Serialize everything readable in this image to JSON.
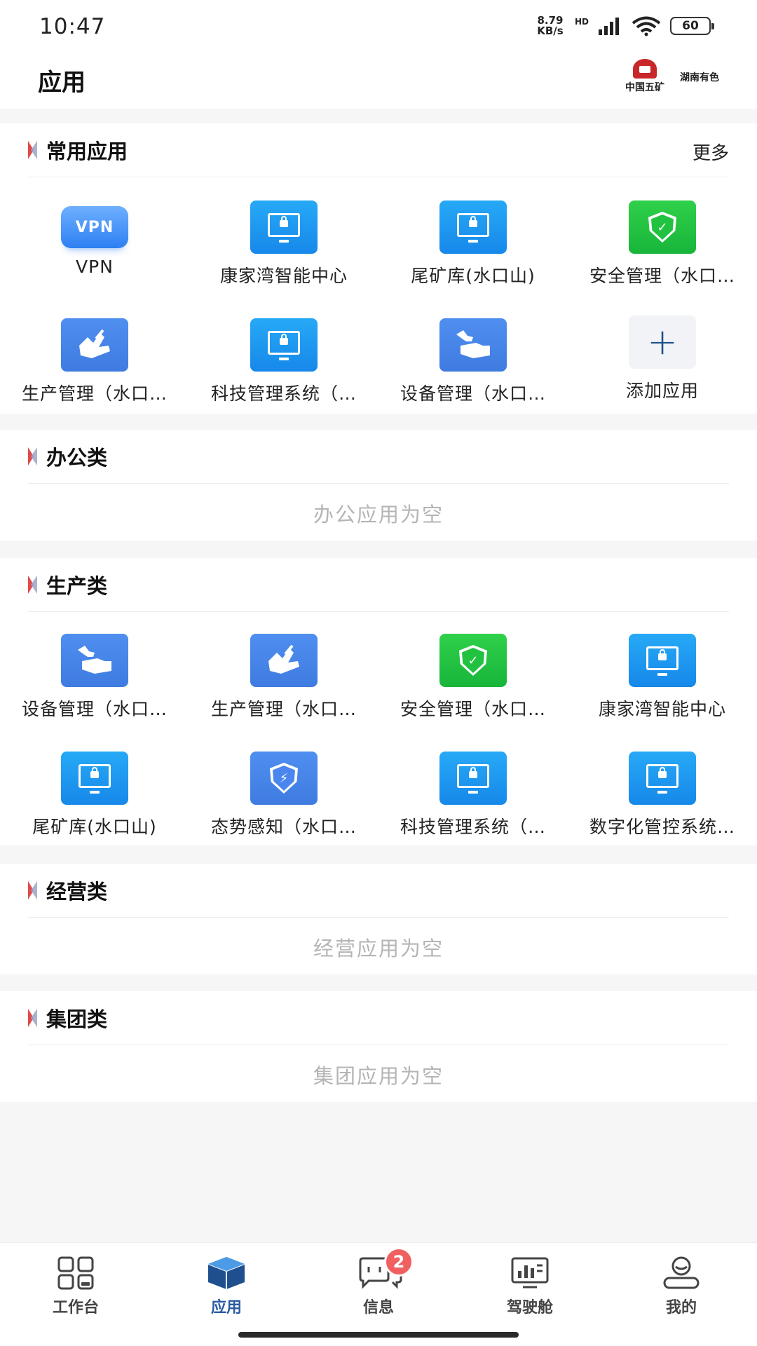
{
  "status_bar": {
    "time": "10:47",
    "net_speed_value": "8.79",
    "net_speed_unit": "KB/s",
    "hd": "HD",
    "battery": "60"
  },
  "header": {
    "title": "应用",
    "logo_left": "中国五矿",
    "logo_right": "湖南有色"
  },
  "common": {
    "title": "常用应用",
    "more": "更多",
    "apps": [
      {
        "label": "VPN",
        "icon": "vpn-icon",
        "icon_text": "VPN"
      },
      {
        "label": "康家湾智能中心",
        "icon": "monitor-lock-icon"
      },
      {
        "label": "尾矿库(水口山)",
        "icon": "monitor-lock-icon"
      },
      {
        "label": "安全管理（水口…",
        "icon": "shield-check-icon"
      },
      {
        "label": "生产管理（水口…",
        "icon": "hand-tool-icon"
      },
      {
        "label": "科技管理系统（…",
        "icon": "monitor-lock-icon"
      },
      {
        "label": "设备管理（水口…",
        "icon": "wrench-hand-icon"
      },
      {
        "label": "添加应用",
        "icon": "plus-icon",
        "icon_text": "+"
      }
    ]
  },
  "office": {
    "title": "办公类",
    "empty": "办公应用为空"
  },
  "production": {
    "title": "生产类",
    "apps": [
      {
        "label": "设备管理（水口…",
        "icon": "wrench-hand-icon"
      },
      {
        "label": "生产管理（水口…",
        "icon": "hand-tool-icon"
      },
      {
        "label": "安全管理（水口…",
        "icon": "shield-check-icon"
      },
      {
        "label": "康家湾智能中心",
        "icon": "monitor-lock-icon"
      },
      {
        "label": "尾矿库(水口山)",
        "icon": "monitor-lock-icon"
      },
      {
        "label": "态势感知（水口…",
        "icon": "shield-network-icon"
      },
      {
        "label": "科技管理系统（…",
        "icon": "monitor-lock-icon"
      },
      {
        "label": "数字化管控系统…",
        "icon": "monitor-lock-icon"
      }
    ]
  },
  "business": {
    "title": "经营类",
    "empty": "经营应用为空"
  },
  "group": {
    "title": "集团类",
    "empty": "集团应用为空"
  },
  "tabbar": {
    "tabs": [
      {
        "label": "工作台",
        "icon": "workbench-icon"
      },
      {
        "label": "应用",
        "icon": "apps-cube-icon",
        "active": true
      },
      {
        "label": "信息",
        "icon": "message-icon",
        "badge": "2"
      },
      {
        "label": "驾驶舱",
        "icon": "dashboard-icon"
      },
      {
        "label": "我的",
        "icon": "profile-icon"
      }
    ]
  },
  "colors": {
    "accent": "#2a5aa0",
    "badge": "#f06060",
    "icon_blue": "#1e98f0",
    "icon_green": "#22c241",
    "empty_text": "#b5b5b5"
  }
}
